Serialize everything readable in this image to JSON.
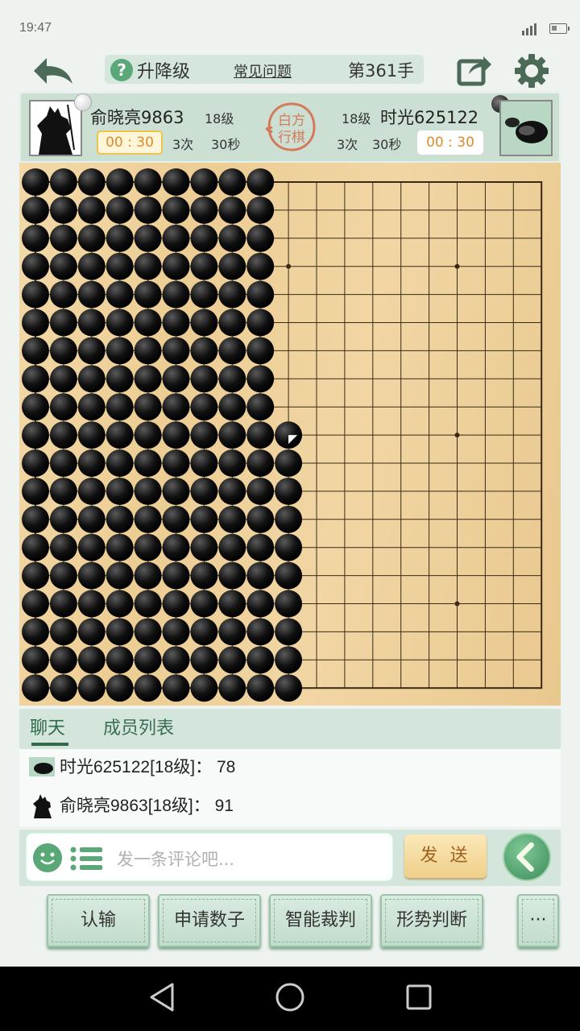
{
  "status_bar": {
    "time": "19:47"
  },
  "top_bar": {
    "question_label": "升降级",
    "faq_link": "常见问题",
    "move_counter": "第361手"
  },
  "player_left": {
    "name": "俞晓亮9863",
    "level": "18级",
    "timer": "00 : 30",
    "tries": "3次",
    "seconds": "30秒",
    "stone": "white"
  },
  "player_right": {
    "name": "时光625122",
    "level": "18级",
    "timer": "00 : 30",
    "tries": "3次",
    "seconds": "30秒",
    "stone": "black"
  },
  "turn_seal": {
    "line1": "白方",
    "line2": "行棋"
  },
  "board": {
    "size": 19,
    "black_columns_full": 9,
    "partial_black_column": {
      "col": 9,
      "from_row": 10
    },
    "last_move": {
      "col": 9,
      "row": 9,
      "color": "white"
    }
  },
  "chat_tabs": {
    "chat": "聊天",
    "members": "成员列表"
  },
  "chat_messages": [
    {
      "author": "时光625122[18级]",
      "sep": "：",
      "text": "78"
    },
    {
      "author": "俞晓亮9863[18级]",
      "sep": "：",
      "text": "91"
    }
  ],
  "comment_input": {
    "placeholder": "发一条评论吧..."
  },
  "send_button": "发 送",
  "action_buttons": {
    "resign": "认输",
    "count": "申请数子",
    "judge": "智能裁判",
    "evaluate": "形势判断",
    "more": "···"
  }
}
